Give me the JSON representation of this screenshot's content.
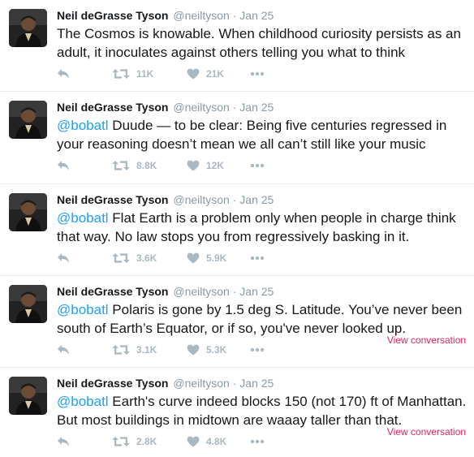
{
  "tweets": [
    {
      "name": "Neil deGrasse Tyson",
      "handle": "@neiltyson",
      "sep": "·",
      "time": "Jan 25",
      "mention": "",
      "text": "The Cosmos is knowable. When childhood curiosity persists as an adult, it inoculates against others telling you what to think",
      "retweets": "11K",
      "likes": "21K",
      "view_conversation": ""
    },
    {
      "name": "Neil deGrasse Tyson",
      "handle": "@neiltyson",
      "sep": "·",
      "time": "Jan 25",
      "mention": "@bobatl",
      "text": " Duude — to be clear: Being five centuries regressed in your reasoning doesn’t mean we all can’t still like your music",
      "retweets": "8.8K",
      "likes": "12K",
      "view_conversation": ""
    },
    {
      "name": "Neil deGrasse Tyson",
      "handle": "@neiltyson",
      "sep": "·",
      "time": "Jan 25",
      "mention": "@bobatl",
      "text": " Flat Earth is a problem only when people in charge think that way. No law stops you from regressively basking in it.",
      "retweets": "3.6K",
      "likes": "5.9K",
      "view_conversation": ""
    },
    {
      "name": "Neil deGrasse Tyson",
      "handle": "@neiltyson",
      "sep": "·",
      "time": "Jan 25",
      "mention": "@bobatl",
      "text": " Polaris is gone by 1.5 deg S. Latitude. You’ve never been south of Earth’s Equator, or if so, you've never looked up.",
      "retweets": "3.1K",
      "likes": "5.3K",
      "view_conversation": "View conversation"
    },
    {
      "name": "Neil deGrasse Tyson",
      "handle": "@neiltyson",
      "sep": "·",
      "time": "Jan 25",
      "mention": "@bobatl",
      "text": " Earth's curve indeed blocks 150 (not 170) ft of Manhattan. But most buildings in midtown are waaay taller than that.",
      "retweets": "2.8K",
      "likes": "4.8K",
      "view_conversation": "View conversation"
    }
  ],
  "icons": {
    "reply": "reply-icon",
    "retweet": "retweet-icon",
    "like": "heart-icon",
    "more": "more-icon"
  },
  "colors": {
    "name": "#14171a",
    "meta": "#8899a6",
    "mention": "#1da1f2",
    "action": "#aab8c2",
    "view_conversation": "#e0245e",
    "divider": "#e6ecf0"
  }
}
